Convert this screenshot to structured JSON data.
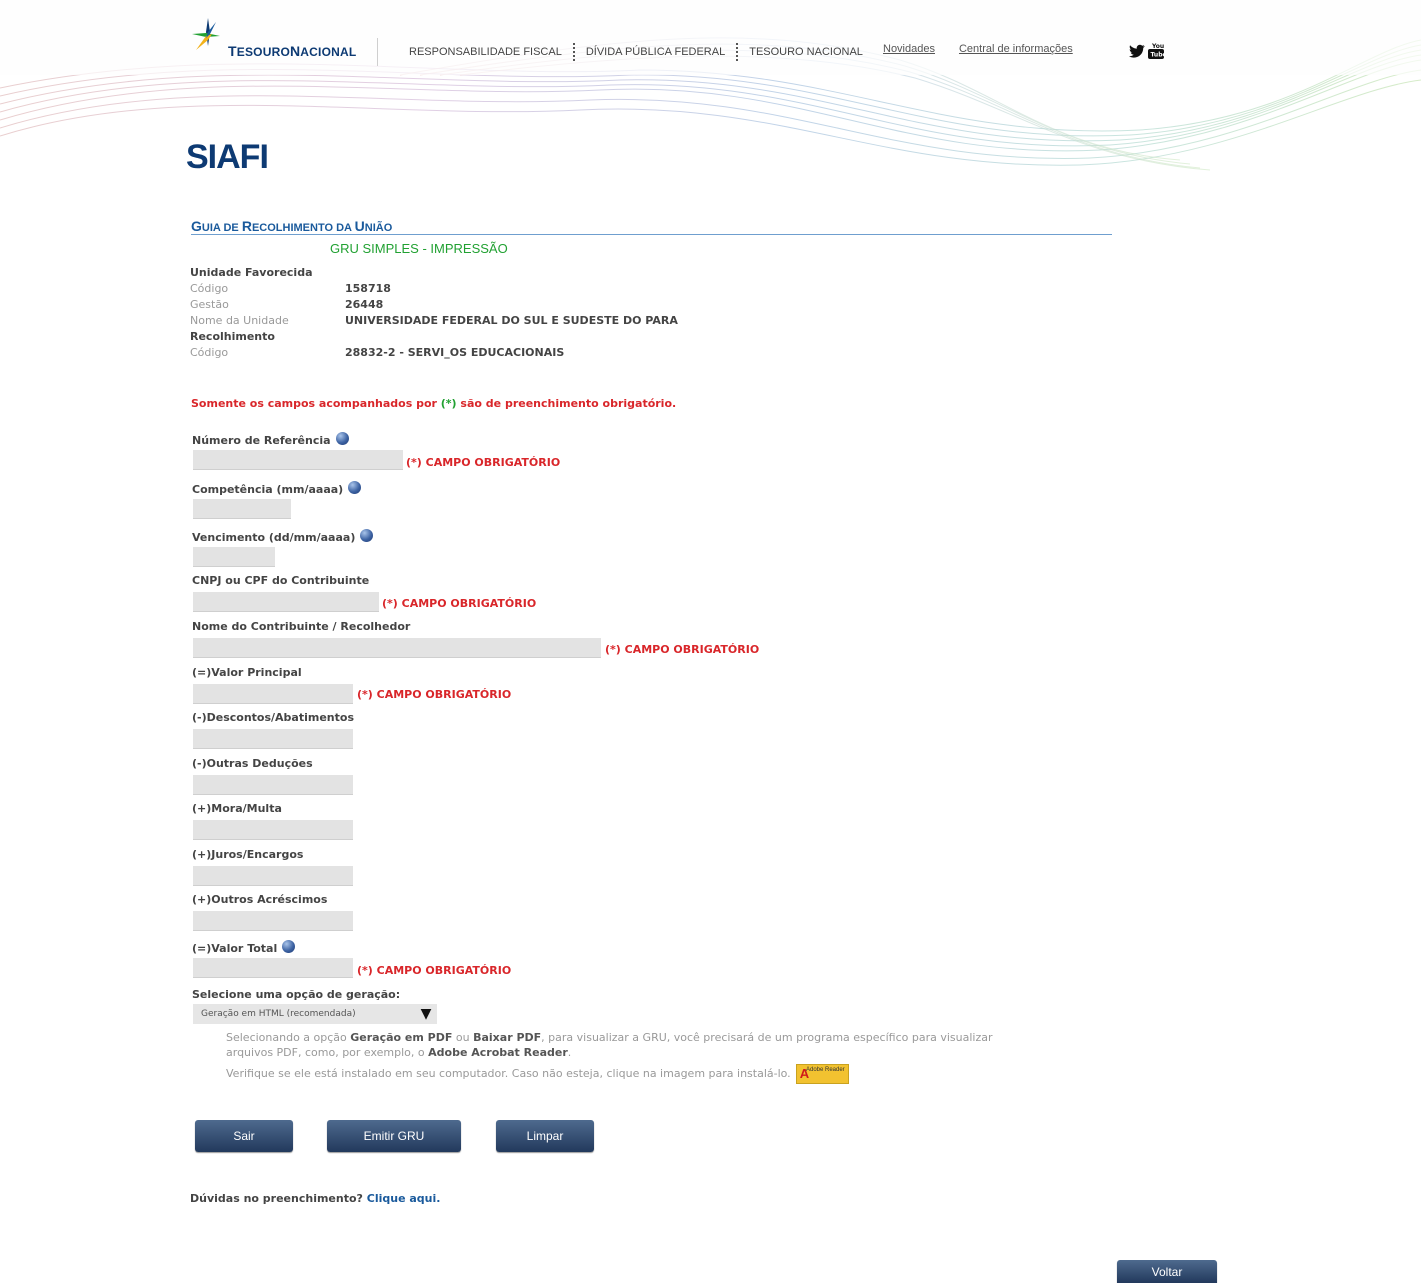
{
  "header": {
    "logo_first": "T",
    "logo_rest": "ESOURO",
    "logo_first2": "N",
    "logo_rest2": "ACIONAL",
    "nav": [
      "RESPONSABILIDADE FISCAL",
      "DÍVIDA PÚBLICA FEDERAL",
      "TESOURO NACIONAL"
    ],
    "links": [
      "Novidades",
      "Central de informações"
    ],
    "social_icons": [
      "twitter-icon",
      "youtube-icon"
    ]
  },
  "page_title": "SIAFI",
  "gru": {
    "title_big1": "G",
    "title_small1": "UIA DE ",
    "title_big2": "R",
    "title_small2": "ECOLHIMENTO DA ",
    "title_big3": "U",
    "title_small3": "NIÃO",
    "subtitle": "GRU SIMPLES - IMPRESSÃO"
  },
  "unidade": {
    "heading": "Unidade Favorecida",
    "codigo_label": "Código",
    "codigo": "158718",
    "gestao_label": "Gestão",
    "gestao": "26448",
    "nome_label": "Nome da Unidade",
    "nome": "UNIVERSIDADE FEDERAL DO SUL E SUDESTE DO PARA"
  },
  "recolhimento": {
    "heading": "Recolhimento",
    "codigo_label": "Código",
    "codigo": "28832-2 - SERVI_OS EDUCACIONAIS"
  },
  "notice": {
    "pre": "Somente os campos acompanhados por ",
    "mark": "(*)",
    "post": " são de preenchimento obrigatório."
  },
  "required_text": "(*) CAMPO OBRIGATÓRIO",
  "fields": {
    "referencia": "Número de Referência",
    "competencia": "Competência (mm/aaaa)",
    "vencimento": "Vencimento (dd/mm/aaaa)",
    "cnpj": "CNPJ ou CPF do Contribuinte",
    "nome": "Nome do Contribuinte / Recolhedor",
    "valor_principal": "(=)Valor Principal",
    "descontos": "(-)Descontos/Abatimentos",
    "deducoes": "(-)Outras Deduções",
    "mora": "(+)Mora/Multa",
    "juros": "(+)Juros/Encargos",
    "acrescimos": "(+)Outros Acréscimos",
    "valor_total": "(=)Valor Total"
  },
  "geracao": {
    "label": "Selecione uma opção de geração:",
    "selected": "Geração em HTML (recomendada)",
    "arrow": "▼"
  },
  "help": {
    "l1a": "Selecionando a opção ",
    "l1b": "Geração em PDF",
    "l1c": " ou ",
    "l1d": "Baixar PDF",
    "l1e": ", para visualizar a GRU, você precisará de um programa específico para visualizar",
    "l2a": "arquivos PDF, como, por exemplo, o ",
    "l2b": "Adobe Acrobat Reader",
    "l2c": ".",
    "l3": "Verifique se ele está instalado em seu computador. Caso não esteja, clique na imagem para instalá-lo.",
    "adobe_brand": "Adobe Reader"
  },
  "buttons": {
    "sair": "Sair",
    "emitir": "Emitir GRU",
    "limpar": "Limpar",
    "voltar": "Voltar"
  },
  "duvidas": {
    "text": "Dúvidas no preenchimento? ",
    "link": "Clique aqui."
  }
}
